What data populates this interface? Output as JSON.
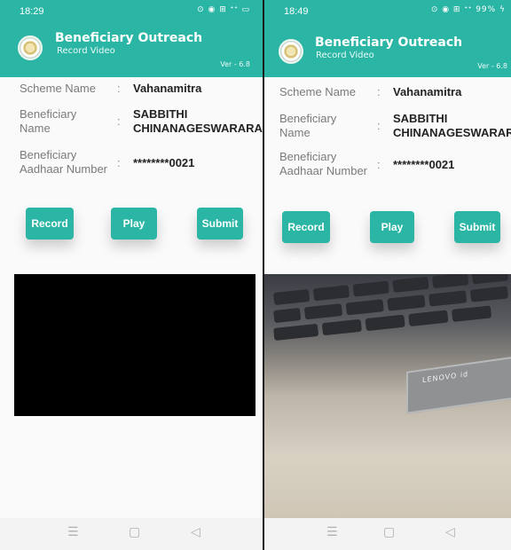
{
  "left": {
    "status_time": "18:29",
    "status_icons": "⊙ ◉ ⊞ ᐩᐩ ▭",
    "app_title": "Beneficiary Outreach",
    "app_subtitle": "Record Video",
    "version": "Ver - 6.8",
    "scheme_label": "Scheme Name",
    "scheme_value": "Vahanamitra",
    "ben_name_label": "Beneficiary Name",
    "ben_name_value_1": "SABBITHI",
    "ben_name_value_2": "CHINANAGESWARARAO",
    "aadhaar_label": "Beneficiary Aadhaar Number",
    "aadhaar_value": "********0021",
    "record_label": "Record",
    "play_label": "Play",
    "submit_label": "Submit"
  },
  "right": {
    "status_time": "18:49",
    "status_icons": "⊙ ◉ ⊞ ᐩᐩ 99% ϟ",
    "app_title": "Beneficiary Outreach",
    "app_subtitle": "Record Video",
    "version": "Ver - 6.8",
    "scheme_label": "Scheme Name",
    "scheme_value": "Vahanamitra",
    "ben_name_label": "Beneficiary Name",
    "ben_name_value_1": "SABBITHI",
    "ben_name_value_2": "CHINANAGESWARARAO",
    "aadhaar_label": "Beneficiary Aadhaar Number",
    "aadhaar_value": "********0021",
    "record_label": "Record",
    "play_label": "Play",
    "submit_label": "Submit",
    "laptop_brand": "LENOVO  id"
  },
  "navbar": {
    "menu_icon": "☰",
    "home_icon": "▢",
    "back_icon": "◁"
  },
  "colors": {
    "accent": "#2bb5a5"
  }
}
